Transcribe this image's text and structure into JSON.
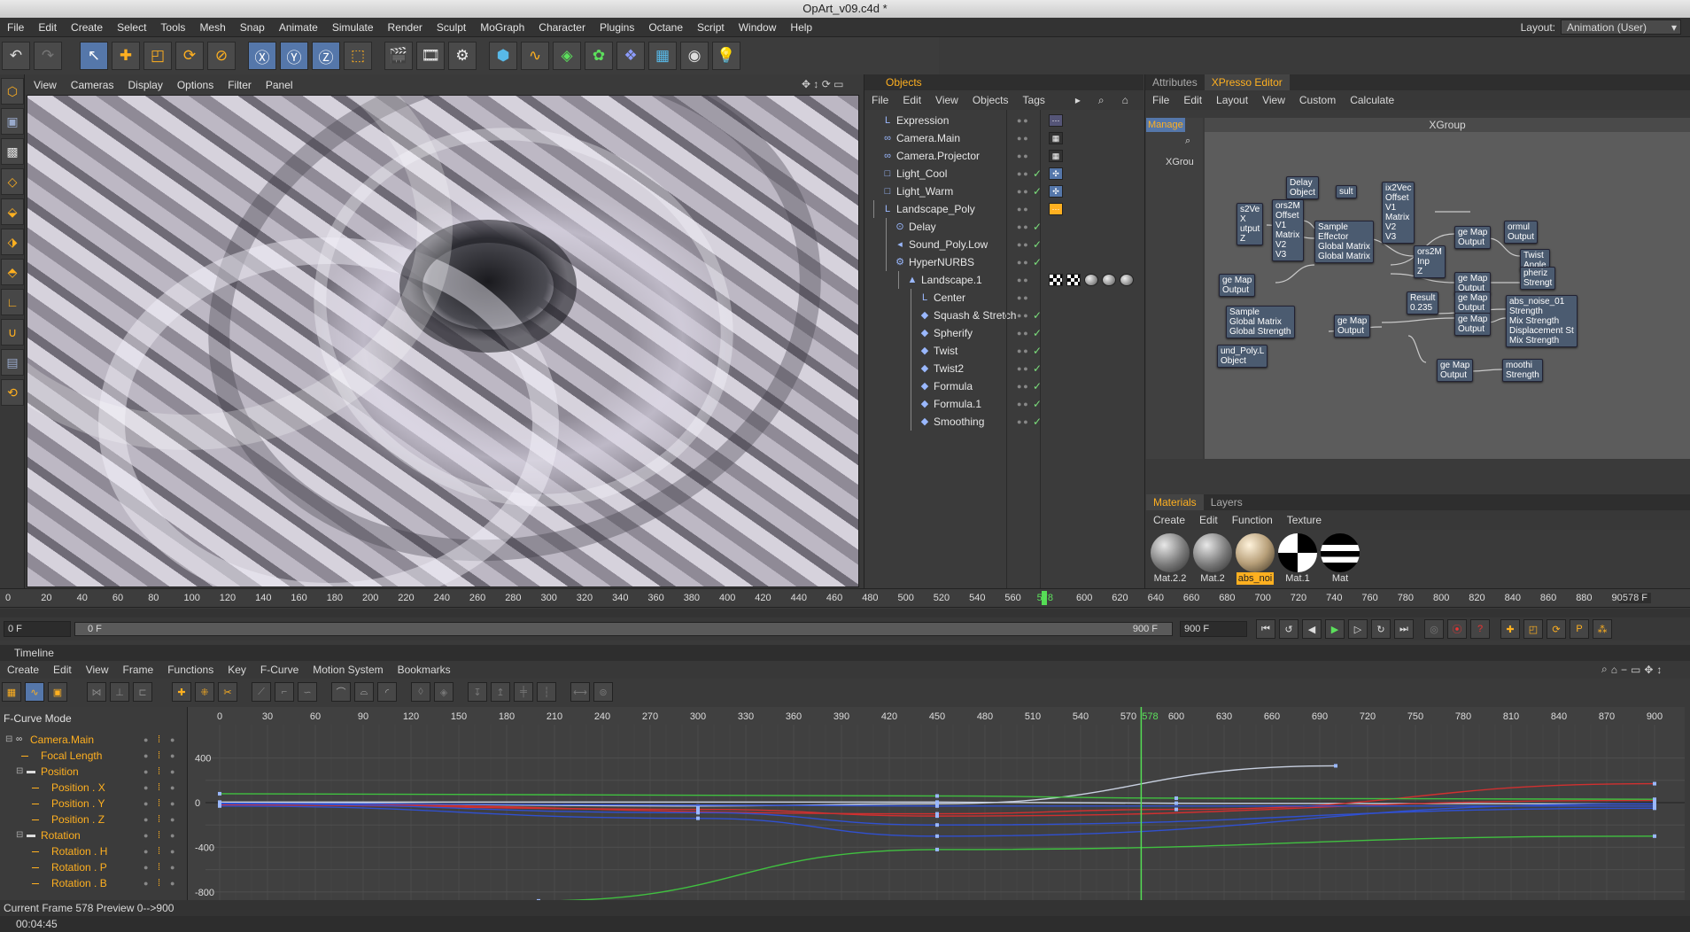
{
  "window": {
    "title": "OpArt_v09.c4d *"
  },
  "menubar": {
    "items": [
      "File",
      "Edit",
      "Create",
      "Select",
      "Tools",
      "Mesh",
      "Snap",
      "Animate",
      "Simulate",
      "Render",
      "Sculpt",
      "MoGraph",
      "Character",
      "Plugins",
      "Octane",
      "Script",
      "Window",
      "Help"
    ],
    "layout_label": "Layout:",
    "layout_value": "Animation (User)"
  },
  "viewport": {
    "menu": [
      "View",
      "Cameras",
      "Display",
      "Options",
      "Filter",
      "Panel"
    ]
  },
  "objects": {
    "title": "Objects",
    "menu": [
      "File",
      "Edit",
      "View",
      "Objects",
      "Tags"
    ],
    "items": [
      {
        "name": "Expression",
        "icon": "null-icon",
        "indent": 0,
        "check": ""
      },
      {
        "name": "Camera.Main",
        "icon": "camera-icon",
        "indent": 0,
        "check": ""
      },
      {
        "name": "Camera.Projector",
        "icon": "camera-icon",
        "indent": 0,
        "check": ""
      },
      {
        "name": "Light_Cool",
        "icon": "light-icon",
        "indent": 0,
        "check": "✓"
      },
      {
        "name": "Light_Warm",
        "icon": "light-icon",
        "indent": 0,
        "check": "✓"
      },
      {
        "name": "Landscape_Poly",
        "icon": "null-icon",
        "indent": 0,
        "check": ""
      },
      {
        "name": "Delay",
        "icon": "effector-icon",
        "indent": 1,
        "check": "✓"
      },
      {
        "name": "Sound_Poly.Low",
        "icon": "sound-icon",
        "indent": 1,
        "check": "✓"
      },
      {
        "name": "HyperNURBS",
        "icon": "nurbs-icon",
        "indent": 1,
        "check": "✓"
      },
      {
        "name": "Landscape.1",
        "icon": "landscape-icon",
        "indent": 2,
        "check": ""
      },
      {
        "name": "Center",
        "icon": "null-icon",
        "indent": 3,
        "check": ""
      },
      {
        "name": "Squash & Stretch",
        "icon": "deformer-icon",
        "indent": 3,
        "check": "✓"
      },
      {
        "name": "Spherify",
        "icon": "deformer-icon",
        "indent": 3,
        "check": "✓"
      },
      {
        "name": "Twist",
        "icon": "deformer-icon",
        "indent": 3,
        "check": "✓"
      },
      {
        "name": "Twist2",
        "icon": "deformer-icon",
        "indent": 3,
        "check": "✓"
      },
      {
        "name": "Formula",
        "icon": "deformer-icon",
        "indent": 3,
        "check": "✓"
      },
      {
        "name": "Formula.1",
        "icon": "deformer-icon",
        "indent": 3,
        "check": "✓"
      },
      {
        "name": "Smoothing",
        "icon": "deformer-icon",
        "indent": 3,
        "check": "✓"
      }
    ]
  },
  "right": {
    "tabs": [
      "Attributes",
      "XPresso Editor"
    ],
    "menu": [
      "File",
      "Edit",
      "Layout",
      "View",
      "Custom",
      "Calculate"
    ],
    "manager_label": "Manage",
    "tree_item": "XGrou",
    "canvas_title": "XGroup",
    "nodes": [
      {
        "text": "Delay\nObject"
      },
      {
        "text": "sult"
      },
      {
        "text": "ix2Vec\nOffset\nV1\nMatrix\nV2\nV3"
      },
      {
        "text": "s2Ve\nX\nutput\nZ"
      },
      {
        "text": "ors2M\nOffset\nV1\nMatrix\nV2\nV3"
      },
      {
        "text": "Sample\nEffector\nGlobal Matrix\nGlobal Matrix"
      },
      {
        "text": "ge Map\nOutput"
      },
      {
        "text": "ormul\nOutput"
      },
      {
        "text": "Twist\nAngle"
      },
      {
        "text": "ge Map\nOutput"
      },
      {
        "text": "pheriz\nStrengt"
      },
      {
        "text": "ge Map\nOutput"
      },
      {
        "text": "Result\n0.235"
      },
      {
        "text": "ge Map\nOutput"
      },
      {
        "text": "abs_noise_01\nStrength\nMix Strength\nDisplacement St\nMix Strength"
      },
      {
        "text": "Sample\nGlobal Matrix\nGlobal Strength"
      },
      {
        "text": "ge Map\nOutput"
      },
      {
        "text": "ge Map\nOutput"
      },
      {
        "text": "und_Poly.L\nObject"
      },
      {
        "text": "ge Map\nOutput"
      },
      {
        "text": "moothi\nStrength"
      },
      {
        "text": "ors2M\nInp\nZ"
      }
    ]
  },
  "materials": {
    "tabs": [
      "Materials",
      "Layers"
    ],
    "menu": [
      "Create",
      "Edit",
      "Function",
      "Texture"
    ],
    "items": [
      {
        "name": "Mat.2.2",
        "kind": "grey-sphere"
      },
      {
        "name": "Mat.2",
        "kind": "grey-sphere"
      },
      {
        "name": "abs_noi",
        "kind": "warm-sphere",
        "selected": true
      },
      {
        "name": "Mat.1",
        "kind": "checker-sphere"
      },
      {
        "name": "Mat",
        "kind": "stripe-sphere"
      }
    ]
  },
  "timeline_ruler": {
    "ticks": [
      "0",
      "20",
      "40",
      "60",
      "80",
      "100",
      "120",
      "140",
      "160",
      "180",
      "200",
      "220",
      "240",
      "260",
      "280",
      "300",
      "320",
      "340",
      "360",
      "380",
      "400",
      "420",
      "440",
      "460",
      "480",
      "500",
      "520",
      "540",
      "560",
      "578",
      "600",
      "620",
      "640",
      "660",
      "680",
      "700",
      "720",
      "740",
      "760",
      "780",
      "800",
      "820",
      "840",
      "860",
      "880",
      "90"
    ],
    "current": "578 F"
  },
  "playbar": {
    "start": "0 F",
    "slider_left": "0 F",
    "slider_right": "900 F",
    "end": "900 F"
  },
  "timeline": {
    "title": "Timeline",
    "menu": [
      "Create",
      "Edit",
      "View",
      "Frame",
      "Functions",
      "Key",
      "F-Curve",
      "Motion System",
      "Bookmarks"
    ],
    "mode": "F-Curve Mode",
    "frames": [
      "0",
      "30",
      "60",
      "90",
      "120",
      "150",
      "180",
      "210",
      "240",
      "270",
      "300",
      "330",
      "360",
      "390",
      "420",
      "450",
      "480",
      "510",
      "540",
      "570",
      "578",
      "600",
      "630",
      "660",
      "690",
      "720",
      "750",
      "780",
      "810",
      "840",
      "870",
      "900"
    ],
    "yvals": [
      "400",
      "0",
      "-400",
      "-800"
    ],
    "tracks": [
      {
        "label": "Camera.Main",
        "level": 0,
        "folder": "camera"
      },
      {
        "label": "Focal Length",
        "level": 1,
        "folder": ""
      },
      {
        "label": "Position",
        "level": 1,
        "folder": "folder"
      },
      {
        "label": "Position . X",
        "level": 2,
        "folder": ""
      },
      {
        "label": "Position . Y",
        "level": 2,
        "folder": ""
      },
      {
        "label": "Position . Z",
        "level": 2,
        "folder": ""
      },
      {
        "label": "Rotation",
        "level": 1,
        "folder": "folder"
      },
      {
        "label": "Rotation . H",
        "level": 2,
        "folder": ""
      },
      {
        "label": "Rotation . P",
        "level": 2,
        "folder": ""
      },
      {
        "label": "Rotation . B",
        "level": 2,
        "folder": ""
      }
    ]
  },
  "status": {
    "current_frame": "Current Frame  578  Preview  0-->900",
    "time": "00:04:45"
  },
  "colors": {
    "accent": "#ffb020",
    "playhead": "#55dd55",
    "curve_red": "#d03030",
    "curve_green": "#40c040",
    "curve_blue": "#3050d0",
    "curve_white": "#c8d0e0"
  }
}
